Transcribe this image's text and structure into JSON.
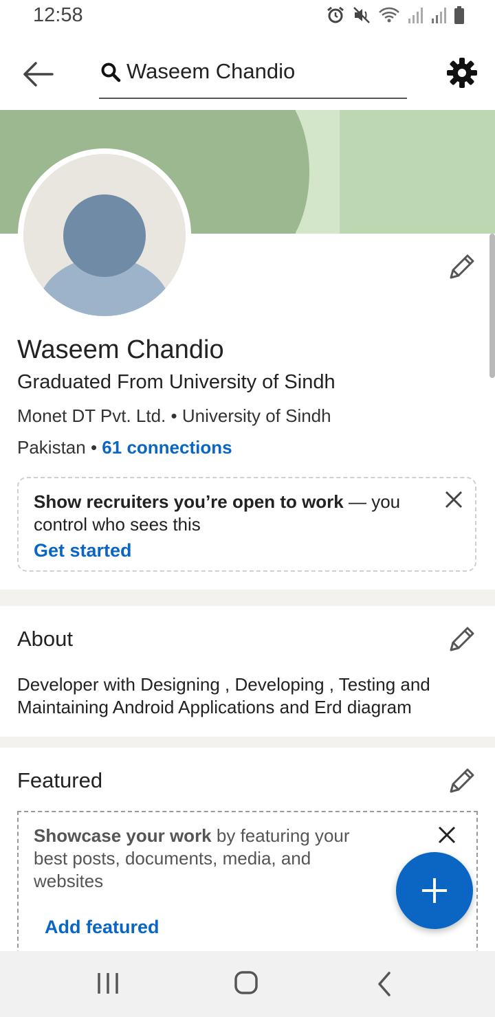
{
  "status_bar": {
    "time": "12:58",
    "icons": [
      "alarm-icon",
      "mute-icon",
      "wifi-icon",
      "signal-icon",
      "signal-icon",
      "battery-icon"
    ]
  },
  "app_bar": {
    "search_value": "Waseem Chandio",
    "icons": [
      "back-arrow-icon",
      "search-icon",
      "gear-icon"
    ]
  },
  "profile": {
    "name": "Waseem Chandio",
    "headline": "Graduated From University of Sindh",
    "company": "Monet DT Pvt. Ltd.",
    "school": "University of Sindh",
    "separator": " • ",
    "location": "Pakistan",
    "connections": "61 connections"
  },
  "open_to_work": {
    "bold_text": "Show recruiters you’re open to work",
    "rest_text": " — you control who sees this",
    "cta": "Get started"
  },
  "about": {
    "title": "About",
    "text": "Developer with Designing , Developing , Testing and Maintaining Android Applications and Erd diagram"
  },
  "featured": {
    "title": "Featured",
    "bold_text": "Showcase your work",
    "rest_text": " by featuring your best posts, documents, media, and websites",
    "cta": "Add featured"
  },
  "colors": {
    "accent": "#0a66c2",
    "cover_green": "#9bb890",
    "cover_light": "#d3e6c9"
  }
}
